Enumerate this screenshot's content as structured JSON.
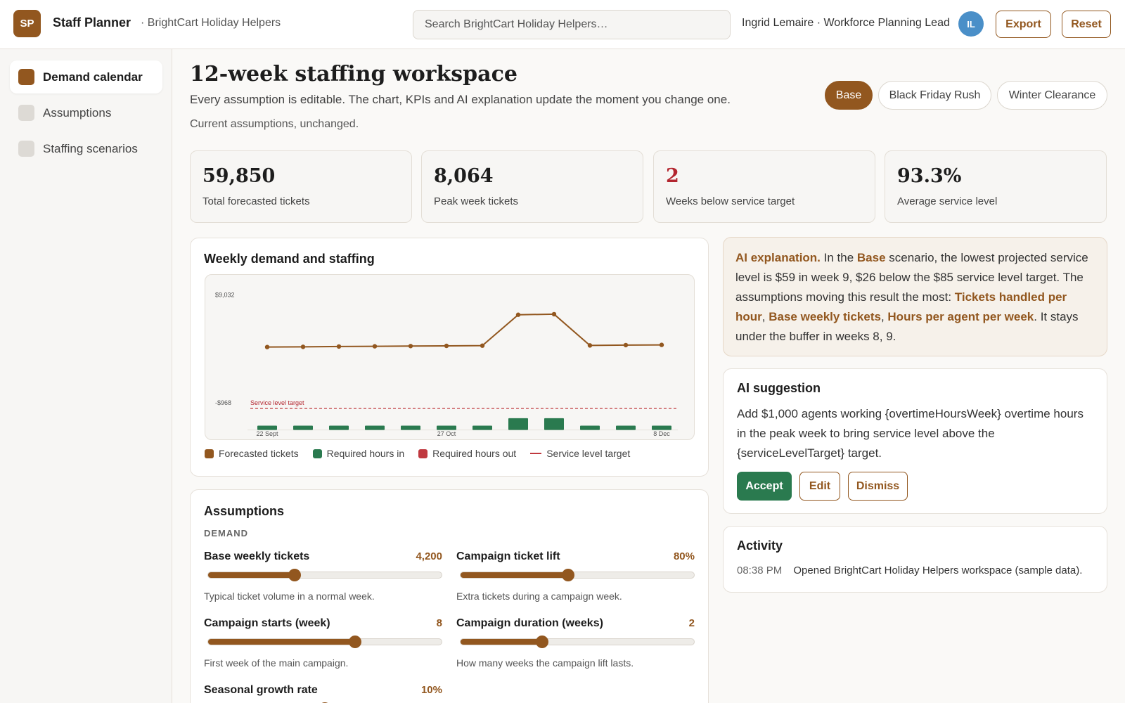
{
  "header": {
    "logo_text": "SP",
    "app_name": "Staff Planner",
    "workspace": "· BrightCart Holiday Helpers",
    "search_placeholder": "Search BrightCart Holiday Helpers…",
    "user": "Ingrid Lemaire · Workforce Planning Lead",
    "avatar": "IL",
    "export_label": "Export",
    "reset_label": "Reset"
  },
  "sidebar": {
    "items": [
      {
        "label": "Demand calendar",
        "active": true
      },
      {
        "label": "Assumptions",
        "active": false
      },
      {
        "label": "Staffing scenarios",
        "active": false
      }
    ]
  },
  "main": {
    "title": "12-week staffing workspace",
    "subtitle": "Every assumption is editable. The chart, KPIs and AI explanation update the moment you change one.",
    "note": "Current assumptions, unchanged.",
    "scenarios": [
      {
        "label": "Base",
        "active": true
      },
      {
        "label": "Black Friday Rush",
        "active": false
      },
      {
        "label": "Winter Clearance",
        "active": false
      }
    ],
    "kpis": [
      {
        "value": "59,850",
        "label": "Total forecasted tickets",
        "status": "normal"
      },
      {
        "value": "8,064",
        "label": "Peak week tickets",
        "status": "normal"
      },
      {
        "value": "2",
        "label": "Weeks below service target",
        "status": "warning"
      },
      {
        "value": "93.3%",
        "label": "Average service level",
        "status": "normal"
      }
    ]
  },
  "chart_card": {
    "title": "Weekly demand and staffing",
    "legend": [
      {
        "label": "Forecasted tickets",
        "color": "#92571f",
        "kind": "square"
      },
      {
        "label": "Required hours in",
        "color": "#2a7a4f",
        "kind": "square"
      },
      {
        "label": "Required hours out",
        "color": "#c0393f",
        "kind": "square"
      },
      {
        "label": "Service level target",
        "color": "#c0393f",
        "kind": "line"
      }
    ]
  },
  "chart_data": {
    "type": "line",
    "y_tick_labels": [
      "$9,032",
      "-$968"
    ],
    "y_ticks": [
      9032,
      -968
    ],
    "x_tick_labels": [
      "22 Sept",
      "27 Oct",
      "8 Dec"
    ],
    "x_tick_indices": [
      0,
      5,
      11
    ],
    "ylim": [
      -4500,
      10900
    ],
    "target_label": "Service level target",
    "target_value": -1500,
    "series": [
      {
        "kind": "line",
        "color": "#92571f",
        "values": [
          4200,
          4220,
          4250,
          4270,
          4290,
          4310,
          4330,
          7200,
          7250,
          4350,
          4380,
          4400
        ]
      },
      {
        "kind": "bar",
        "color": "#2a7a4f",
        "values": [
          -3100,
          -3100,
          -3100,
          -3100,
          -3100,
          -3100,
          -3100,
          -2400,
          -2400,
          -3100,
          -3100,
          -3100
        ]
      }
    ],
    "grid": false
  },
  "assumptions": {
    "title": "Assumptions",
    "section": "DEMAND",
    "sliders": [
      {
        "name": "Base weekly tickets",
        "value": "4,200",
        "fraction": 0.37,
        "help": "Typical ticket volume in a normal week."
      },
      {
        "name": "Campaign ticket lift",
        "value": "80%",
        "fraction": 0.46,
        "help": "Extra tickets during a campaign week."
      },
      {
        "name": "Campaign starts (week)",
        "value": "8",
        "fraction": 0.63,
        "help": "First week of the main campaign."
      },
      {
        "name": "Campaign duration (weeks)",
        "value": "2",
        "fraction": 0.35,
        "help": "How many weeks the campaign lift lasts."
      },
      {
        "name": "Seasonal growth rate",
        "value": "10%",
        "fraction": 0.5,
        "help": ""
      }
    ]
  },
  "ai_explanation": {
    "label": "AI explanation.",
    "t1": " In the ",
    "scenario": "Base",
    "t2": " scenario, the lowest projected service level is $59 in week 9, $26 below the $85 service level target. The assumptions moving this result the most: ",
    "d1": "Tickets handled per hour",
    "sep1": ", ",
    "d2": "Base weekly tickets",
    "sep2": ", ",
    "d3": "Hours per agent per week",
    "t3": ". It stays under the buffer in weeks 8, 9."
  },
  "ai_suggestion": {
    "title": "AI suggestion",
    "text": "Add $1,000 agents working {overtimeHoursWeek} overtime hours in the peak week to bring service level above the {serviceLevelTarget} target.",
    "accept_label": "Accept",
    "edit_label": "Edit",
    "dismiss_label": "Dismiss"
  },
  "activity": {
    "title": "Activity",
    "entries": [
      {
        "time": "08:38 PM",
        "text": "Opened BrightCart Holiday Helpers workspace (sample data)."
      }
    ]
  }
}
